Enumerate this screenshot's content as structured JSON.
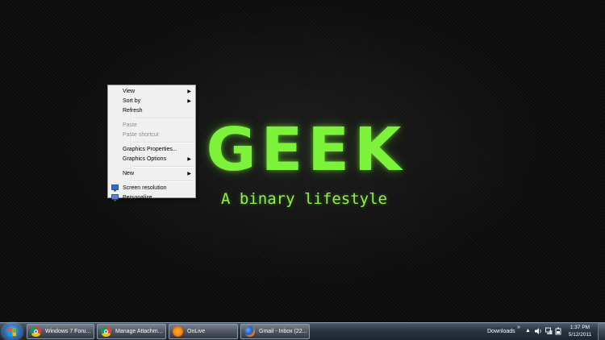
{
  "wallpaper": {
    "title": "GEEK",
    "subtitle": "A binary lifestyle",
    "accent_color": "#7cf23a"
  },
  "context_menu": {
    "items": [
      {
        "label": "View",
        "submenu": true,
        "enabled": true
      },
      {
        "label": "Sort by",
        "submenu": true,
        "enabled": true
      },
      {
        "label": "Refresh",
        "submenu": false,
        "enabled": true
      },
      {
        "label": "Paste",
        "submenu": false,
        "enabled": false
      },
      {
        "label": "Paste shortcut",
        "submenu": false,
        "enabled": false
      },
      {
        "label": "Graphics Properties...",
        "submenu": false,
        "enabled": true
      },
      {
        "label": "Graphics Options",
        "submenu": true,
        "enabled": true
      },
      {
        "label": "New",
        "submenu": true,
        "enabled": true
      },
      {
        "label": "Screen resolution",
        "submenu": false,
        "enabled": true,
        "icon": "screen-resolution-icon"
      },
      {
        "label": "Personalize",
        "submenu": false,
        "enabled": true,
        "icon": "personalize-icon"
      }
    ]
  },
  "taskbar": {
    "start_icon": "windows-start-orb",
    "buttons": [
      {
        "label": "Windows 7 Foru...",
        "icon": "chrome-icon"
      },
      {
        "label": "Manage Attachm...",
        "icon": "chrome-icon"
      },
      {
        "label": "OnLive",
        "icon": "onlive-icon"
      },
      {
        "label": "Gmail - Inbox (22...",
        "icon": "firefox-icon"
      }
    ],
    "tray": {
      "toolbar_label": "Downloads",
      "time": "1:37 PM",
      "date": "5/12/2011"
    }
  }
}
